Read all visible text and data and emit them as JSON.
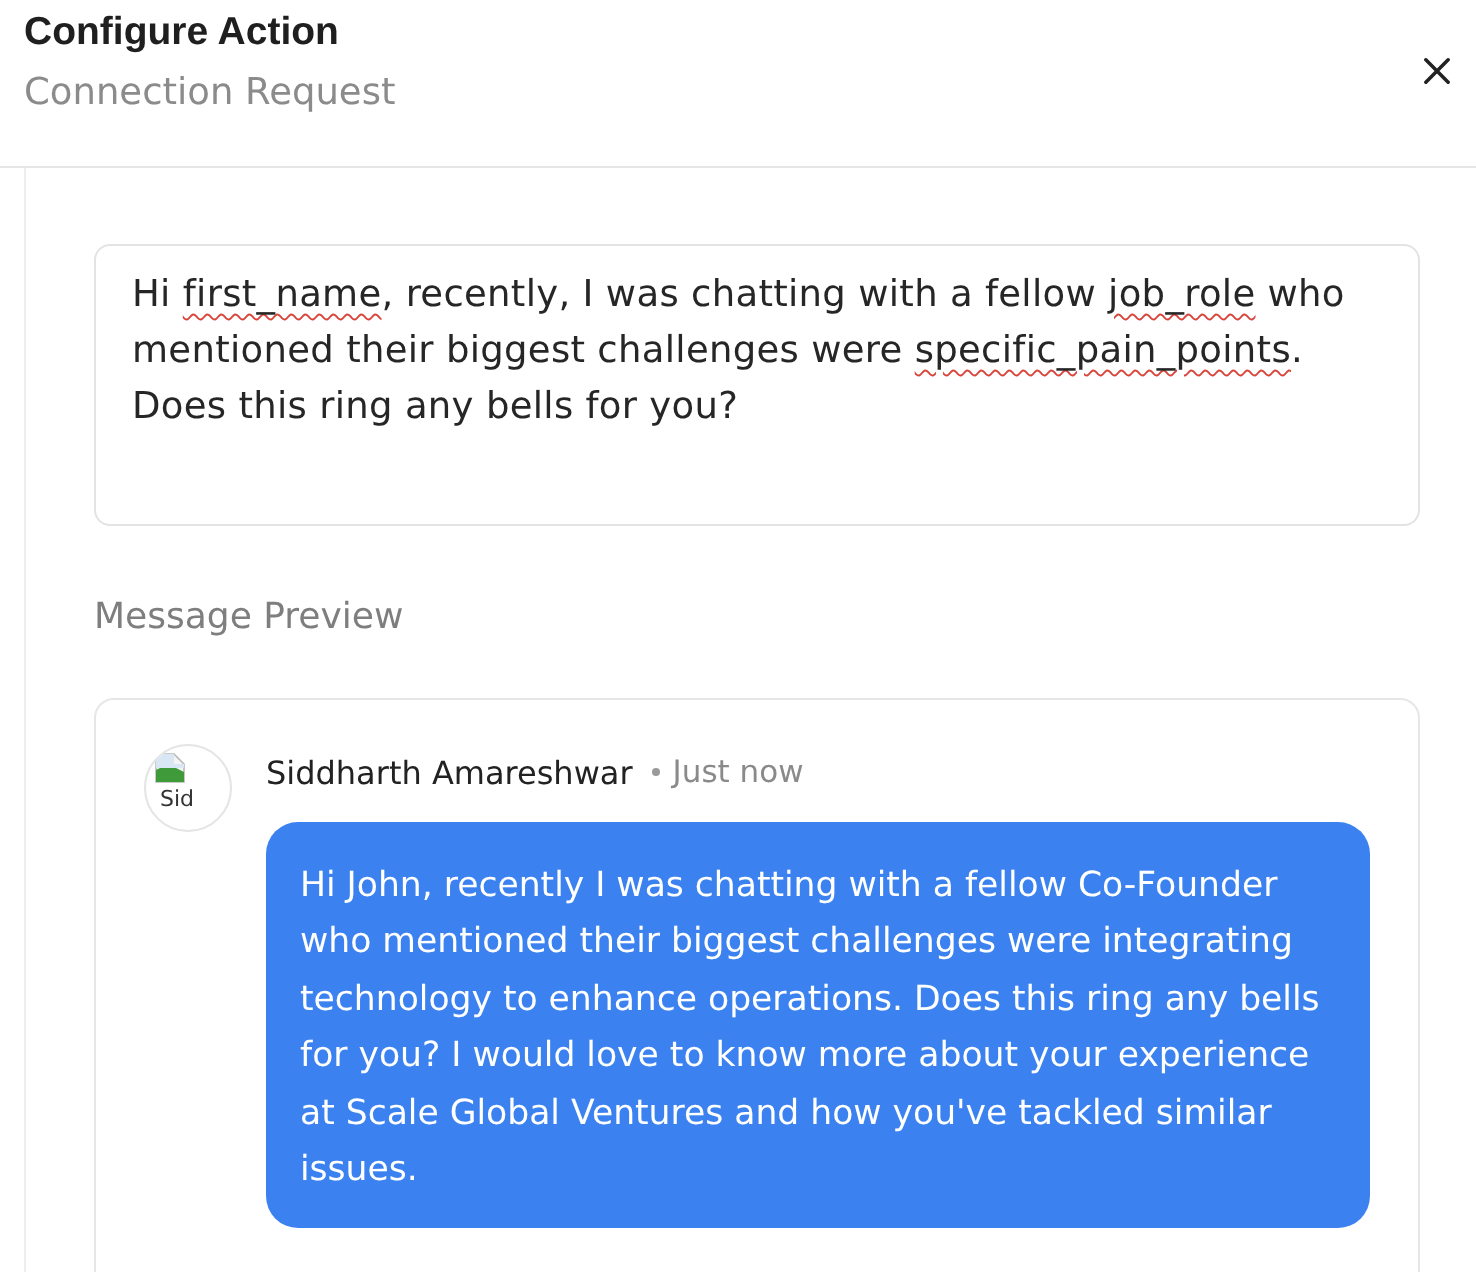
{
  "dialog": {
    "title": "Configure Action",
    "subtitle": "Connection Request"
  },
  "message_editor": {
    "segments": [
      {
        "text": "Hi ",
        "flagged": false
      },
      {
        "text": "first_name",
        "flagged": true
      },
      {
        "text": ", recently, I was chatting with a fellow ",
        "flagged": false
      },
      {
        "text": "job_role",
        "flagged": true
      },
      {
        "text": " who mentioned their biggest challenges were ",
        "flagged": false
      },
      {
        "text": "specific_pain_points",
        "flagged": true
      },
      {
        "text": ". Does this ring any bells for you?",
        "flagged": false
      }
    ]
  },
  "preview": {
    "label": "Message Preview",
    "sender": {
      "name": "Siddharth Amareshwar",
      "avatar_alt": "Sid",
      "time": "Just now"
    },
    "bubble": "Hi John, recently I was chatting with a fellow Co-Founder who mentioned their biggest challenges were integrating technology to enhance operations. Does this ring any bells for you? I would love to know more about your experience at Scale Global Ventures and how you've tackled similar issues."
  }
}
